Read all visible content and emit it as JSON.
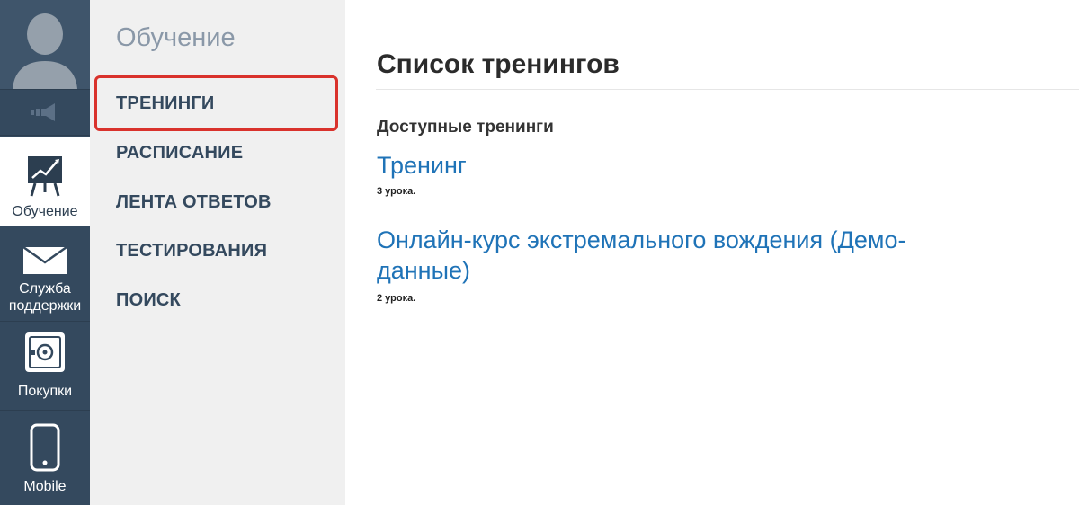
{
  "rail": {
    "items": [
      {
        "label": "Обучение",
        "icon": "chart-board-icon"
      },
      {
        "label": "Служба поддержки",
        "line1": "Служба",
        "line2": "поддержки",
        "icon": "envelope-icon"
      },
      {
        "label": "Покупки",
        "icon": "safe-icon"
      },
      {
        "label": "Mobile",
        "icon": "phone-icon"
      }
    ],
    "colors": {
      "background": "#34495e",
      "active_background": "#ffffff"
    }
  },
  "subnav": {
    "title": "Обучение",
    "items": [
      {
        "label": "ТРЕНИНГИ",
        "highlighted": true
      },
      {
        "label": "РАСПИСАНИЕ"
      },
      {
        "label": "ЛЕНТА ОТВЕТОВ"
      },
      {
        "label": "ТЕСТИРОВАНИЯ"
      },
      {
        "label": "ПОИСК"
      }
    ],
    "highlight_color": "#d9322c"
  },
  "main": {
    "title": "Список тренингов",
    "section_title": "Доступные тренинги",
    "trainings": [
      {
        "title": "Тренинг",
        "lessons": "3 урока."
      },
      {
        "title_line1": "Онлайн-курс экстремального вождения (Демо-",
        "title_line2": "данные)",
        "title": "Онлайн-курс экстремального вождения (Демо-данные)",
        "lessons": "2 урока."
      }
    ],
    "link_color": "#1f73b7"
  }
}
